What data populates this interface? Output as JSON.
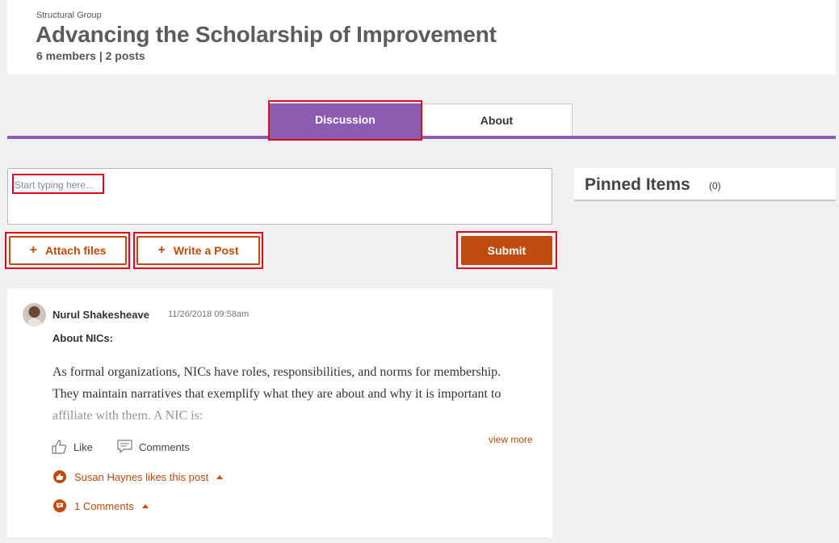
{
  "header": {
    "group_type": "Structural Group",
    "title": "Advancing the Scholarship of Improvement",
    "meta": "6 members | 2 posts"
  },
  "tabs": [
    {
      "label": "Discussion",
      "active": true
    },
    {
      "label": "About",
      "active": false
    }
  ],
  "composer": {
    "placeholder": "Start typing here...",
    "value": ""
  },
  "actions": {
    "attach_label": "Attach files",
    "write_label": "Write a Post",
    "submit_label": "Submit",
    "plus_glyph": "+"
  },
  "pinned": {
    "title": "Pinned Items",
    "count": "(0)"
  },
  "post": {
    "author": "Nurul Shakesheave",
    "timestamp": "11/26/2018 09:58am",
    "heading": "About NICs:",
    "body": "As formal organizations, NICs have roles, responsibilities, and norms for membership. They maintain narratives that exemplify what they are about and why it is important to affiliate with them. A NIC is:",
    "view_more": "view more",
    "like_label": "Like",
    "comments_label": "Comments",
    "likes_summary": "Susan Haynes likes this post",
    "comments_summary": "1 Comments"
  },
  "colors": {
    "accent_purple": "#8d5bb1",
    "accent_orange": "#c04b0c",
    "highlight_red": "#e3001b"
  },
  "icons": {
    "like": "thumbs-up-icon",
    "comments": "comment-icon",
    "likes_badge": "thumbs-up-badge-icon",
    "comments_badge": "comment-badge-icon",
    "caret": "caret-up-icon"
  }
}
